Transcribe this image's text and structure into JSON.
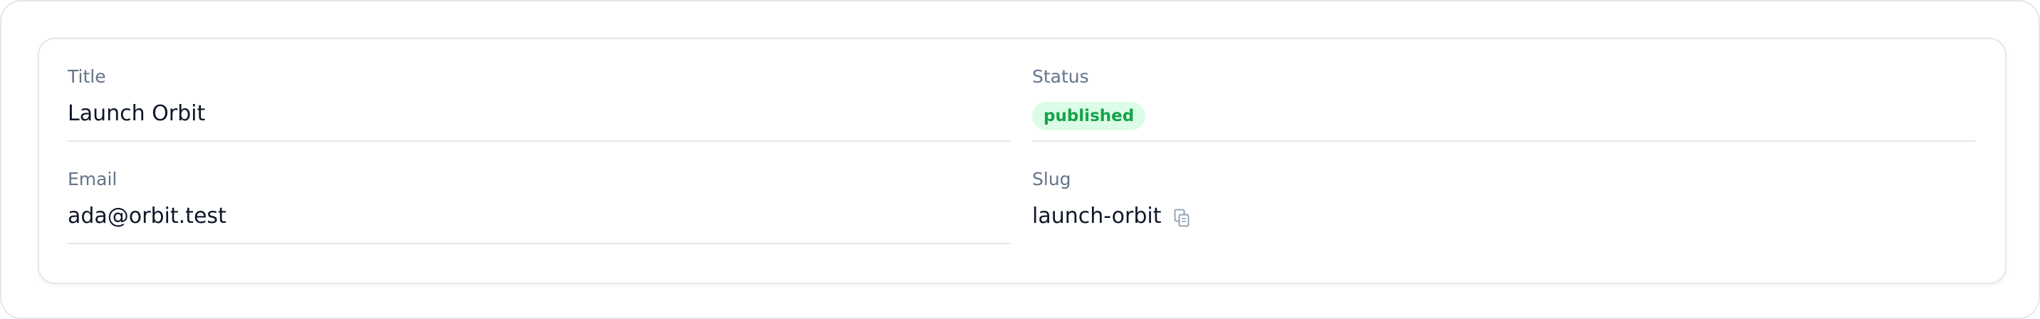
{
  "fields": {
    "title": {
      "label": "Title",
      "value": "Launch Orbit"
    },
    "status": {
      "label": "Status",
      "value": "published",
      "color": "#16a34a",
      "background": "#dcfce7"
    },
    "email": {
      "label": "Email",
      "value": "ada@orbit.test"
    },
    "slug": {
      "label": "Slug",
      "value": "launch-orbit",
      "icon": "copy-icon"
    }
  }
}
